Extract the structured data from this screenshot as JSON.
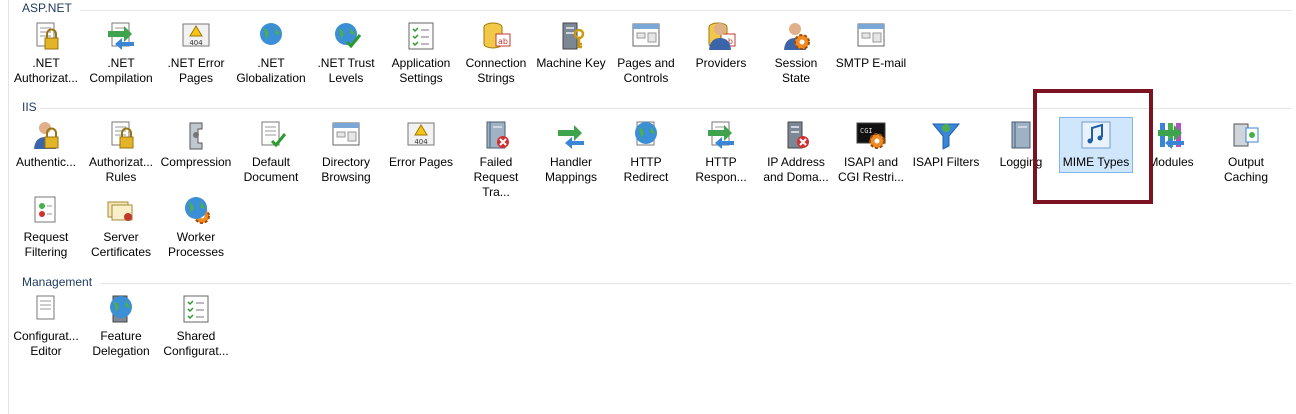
{
  "colors": {
    "accent": "#7b1320",
    "group_header": "#1e395b",
    "selection": "#cfe6fb"
  },
  "groups": {
    "aspnet": {
      "title": "ASP.NET",
      "items": [
        {
          "label": ".NET\nAuthorizat...",
          "icon": "lock-doc-icon"
        },
        {
          "label": ".NET\nCompilation",
          "icon": "compile-arrow-icon"
        },
        {
          "label": ".NET Error\nPages",
          "icon": "error-404-icon"
        },
        {
          "label": ".NET\nGlobalization",
          "icon": "globe-icon"
        },
        {
          "label": ".NET Trust\nLevels",
          "icon": "globe-check-icon"
        },
        {
          "label": "Application\nSettings",
          "icon": "checklist-icon"
        },
        {
          "label": "Connection\nStrings",
          "icon": "database-ab-icon"
        },
        {
          "label": "Machine Key",
          "icon": "server-key-icon"
        },
        {
          "label": "Pages and\nControls",
          "icon": "pages-controls-icon"
        },
        {
          "label": "Providers",
          "icon": "providers-icon"
        },
        {
          "label": "Session State",
          "icon": "session-user-icon"
        },
        {
          "label": "SMTP E-mail",
          "icon": "smtp-mail-icon"
        }
      ]
    },
    "iis": {
      "title": "IIS",
      "items": [
        {
          "label": "Authentic...",
          "icon": "user-lock-icon"
        },
        {
          "label": "Authorizat...\nRules",
          "icon": "lock-doc-icon"
        },
        {
          "label": "Compression",
          "icon": "clamp-icon"
        },
        {
          "label": "Default\nDocument",
          "icon": "default-doc-icon"
        },
        {
          "label": "Directory\nBrowsing",
          "icon": "directory-browse-icon"
        },
        {
          "label": "Error Pages",
          "icon": "error-404-icon"
        },
        {
          "label": "Failed\nRequest Tra...",
          "icon": "failed-request-icon"
        },
        {
          "label": "Handler\nMappings",
          "icon": "handler-arrows-icon"
        },
        {
          "label": "HTTP\nRedirect",
          "icon": "http-redirect-icon"
        },
        {
          "label": "HTTP\nRespon...",
          "icon": "http-response-icon"
        },
        {
          "label": "IP Address\nand Doma...",
          "icon": "ip-restrict-icon"
        },
        {
          "label": "ISAPI and\nCGI Restri...",
          "icon": "cgi-console-icon"
        },
        {
          "label": "ISAPI Filters",
          "icon": "funnel-icon"
        },
        {
          "label": "Logging",
          "icon": "log-book-icon"
        },
        {
          "label": "MIME Types",
          "icon": "mime-music-icon"
        },
        {
          "label": "Modules",
          "icon": "modules-icon"
        },
        {
          "label": "Output\nCaching",
          "icon": "output-cache-icon"
        },
        {
          "label": "Request\nFiltering",
          "icon": "request-filter-icon"
        },
        {
          "label": "Server\nCertificates",
          "icon": "certificate-icon"
        },
        {
          "label": "Worker\nProcesses",
          "icon": "worker-gear-icon"
        }
      ]
    },
    "management": {
      "title": "Management",
      "items": [
        {
          "label": "Configurat...\nEditor",
          "icon": "config-editor-icon"
        },
        {
          "label": "Feature\nDelegation",
          "icon": "feature-delegation-icon"
        },
        {
          "label": "Shared\nConfigurat...",
          "icon": "shared-config-icon"
        }
      ]
    }
  },
  "selected": "MIME Types"
}
